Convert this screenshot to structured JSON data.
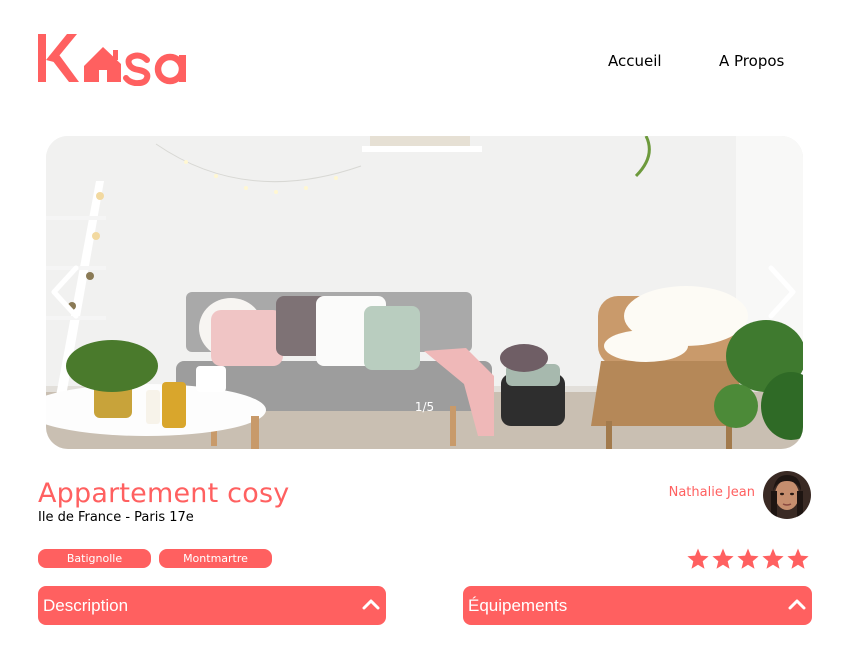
{
  "header": {
    "logo_text": "Kasa",
    "nav": {
      "home": "Accueil",
      "about": "A Propos"
    }
  },
  "gallery": {
    "counter": "1/5"
  },
  "listing": {
    "title": "Appartement cosy",
    "location": "Ile de France - Paris 17e",
    "host_name": "Nathalie Jean",
    "tags": [
      "Batignolle",
      "Montmartre"
    ],
    "rating": 5,
    "rating_max": 5
  },
  "collapses": {
    "description": "Description",
    "equipments": "Équipements"
  },
  "colors": {
    "brand": "#FF6060",
    "text": "#000000",
    "background": "#FFFFFF"
  },
  "icons": {
    "prev": "chevron-left-icon",
    "next": "chevron-right-icon",
    "collapse": "chevron-up-icon",
    "rating": "star-icon"
  }
}
